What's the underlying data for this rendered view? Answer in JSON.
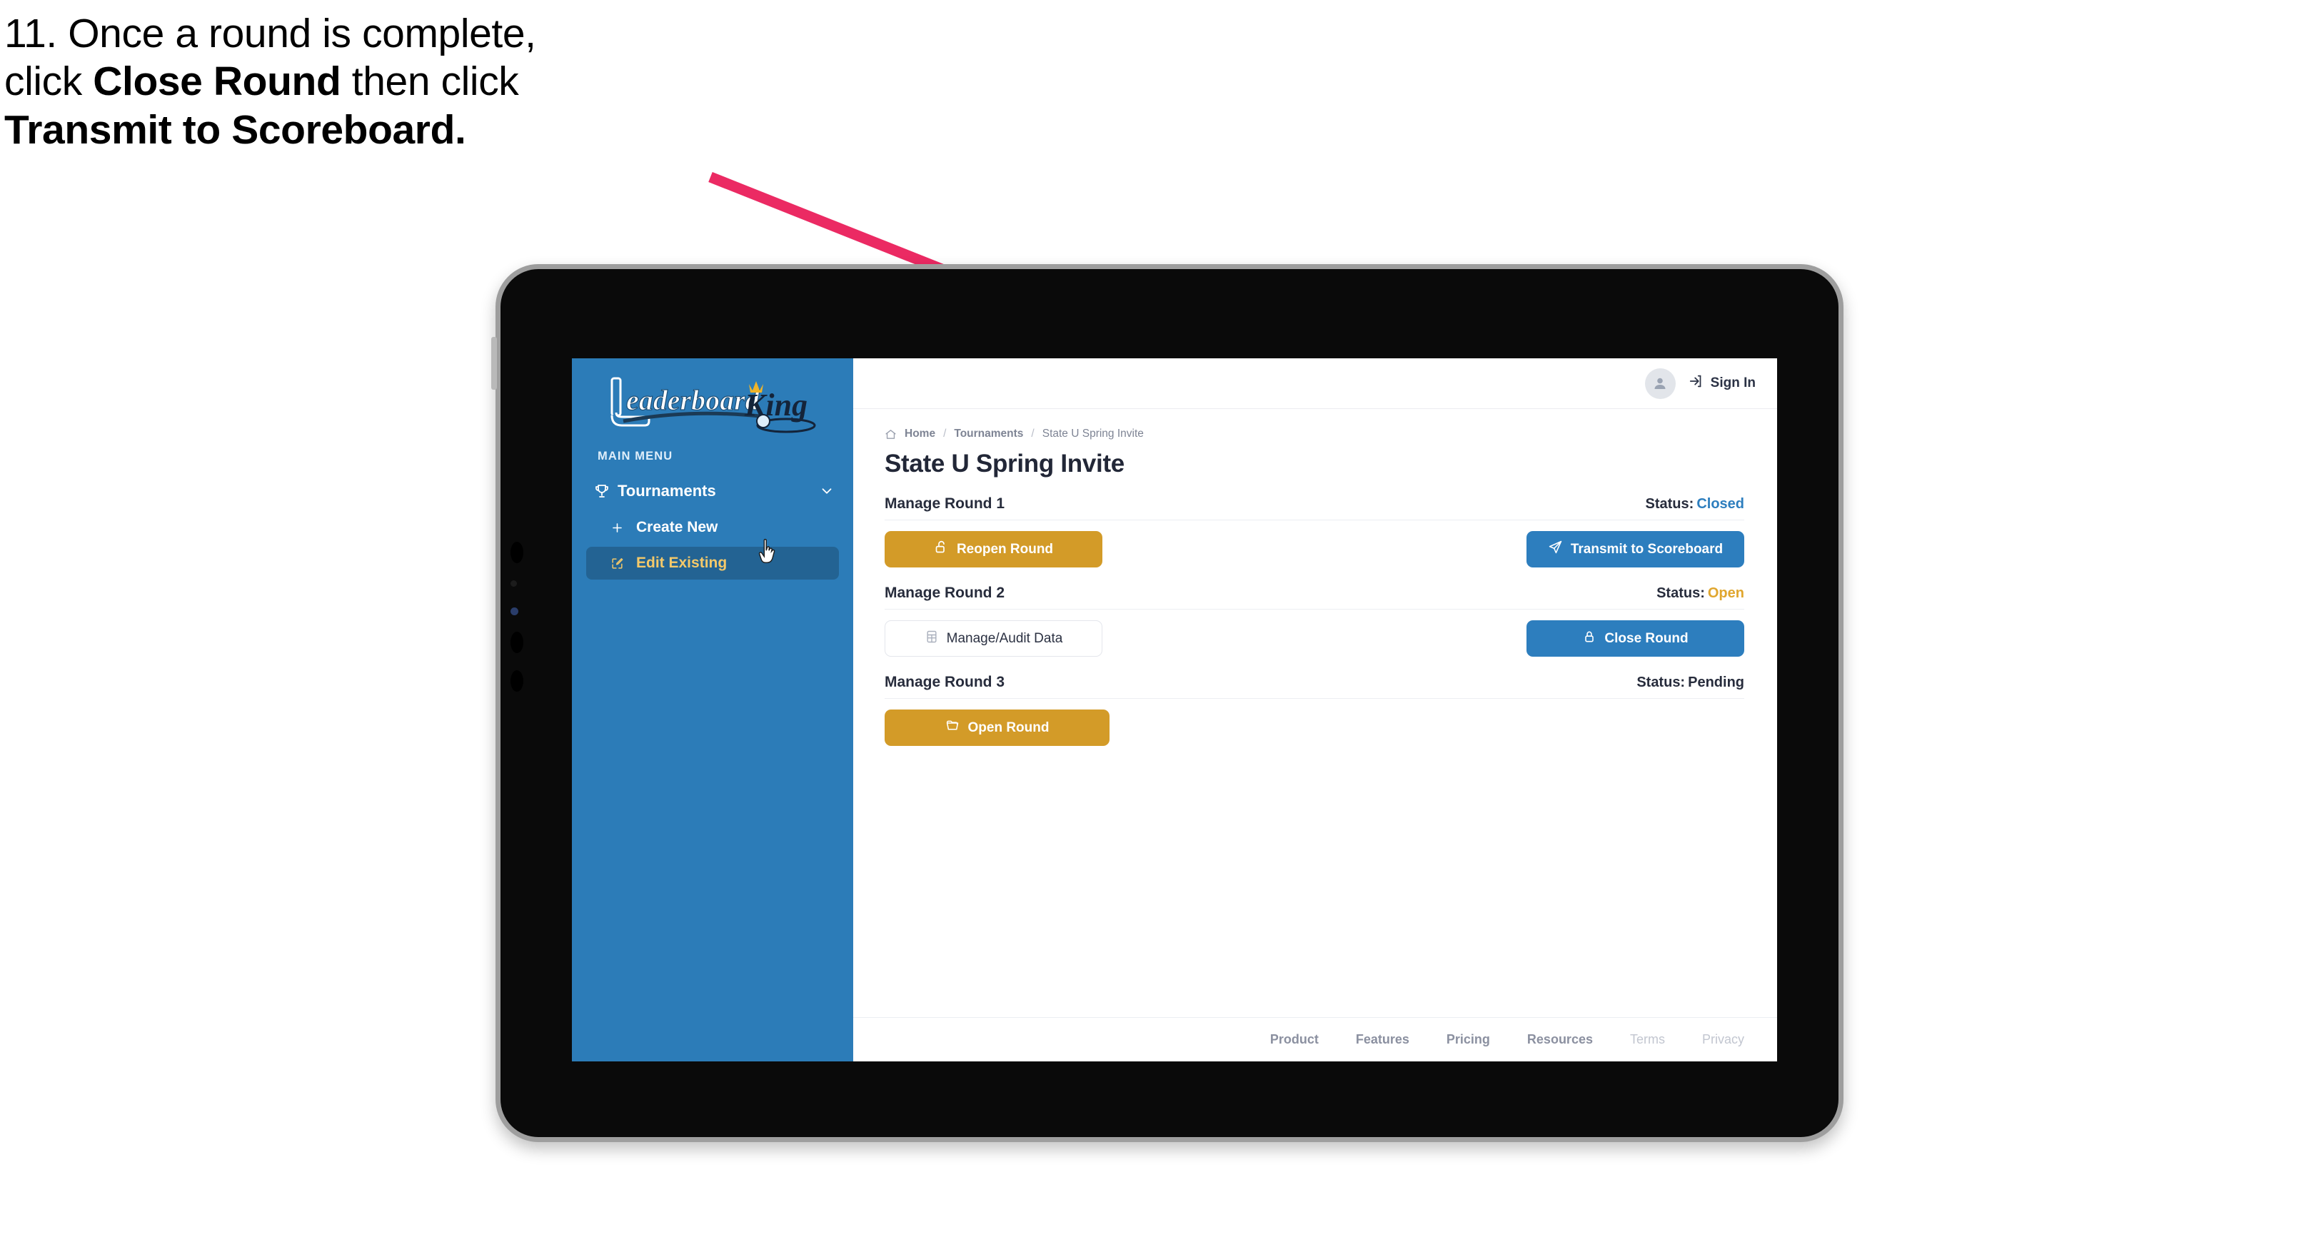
{
  "instruction": {
    "number": "11.",
    "line1_pre": "11. Once a round is complete,",
    "line2_pre": "click ",
    "line2_bold": "Close Round",
    "line2_post": " then click",
    "line3_bold": "Transmit to Scoreboard."
  },
  "app": {
    "logo_primary": "Leaderboard",
    "logo_secondary": "King",
    "sidebar": {
      "section_label": "MAIN MENU",
      "items": [
        {
          "label": "Tournaments",
          "icon": "trophy-icon",
          "expander": "chevron-down-icon",
          "active": false
        },
        {
          "label": "Create New",
          "icon": "plus-icon",
          "active": false
        },
        {
          "label": "Edit Existing",
          "icon": "edit-square-icon",
          "active": true
        }
      ]
    },
    "topbar": {
      "avatar": "user-avatar-icon",
      "signin_label": "Sign In",
      "signin_icon": "login-arrow-icon"
    },
    "breadcrumb": {
      "home_icon": "home-icon",
      "items": [
        "Home",
        "Tournaments",
        "State U Spring Invite"
      ],
      "separator": "/"
    },
    "page_title": "State U Spring Invite",
    "rounds": [
      {
        "name": "Manage Round 1",
        "status_label": "Status:",
        "status_value": "Closed",
        "status_color": "#2d7ebe",
        "left_button": {
          "label": "Reopen Round",
          "icon": "unlock-icon",
          "style": "gold"
        },
        "right_button": {
          "label": "Transmit to Scoreboard",
          "icon": "paper-plane-icon",
          "style": "blue"
        }
      },
      {
        "name": "Manage Round 2",
        "status_label": "Status:",
        "status_value": "Open",
        "status_color": "#e0a62e",
        "left_button": {
          "label": "Manage/Audit Data",
          "icon": "table-grid-icon",
          "style": "ghost"
        },
        "right_button": {
          "label": "Close Round",
          "icon": "lock-icon",
          "style": "blue"
        }
      },
      {
        "name": "Manage Round 3",
        "status_label": "Status:",
        "status_value": "Pending",
        "status_color": "#272c3c",
        "left_button": {
          "label": "Open Round",
          "icon": "folder-open-icon",
          "style": "gold"
        },
        "right_button": null
      }
    ],
    "footer": {
      "links": [
        {
          "label": "Product",
          "muted": false
        },
        {
          "label": "Features",
          "muted": false
        },
        {
          "label": "Pricing",
          "muted": false
        },
        {
          "label": "Resources",
          "muted": false
        },
        {
          "label": "Terms",
          "muted": true
        },
        {
          "label": "Privacy",
          "muted": true
        }
      ]
    }
  },
  "colors": {
    "sidebar_blue": "#2c7cb8",
    "sidebar_active": "#236393",
    "accent_gold": "#d39b28",
    "accent_gold_text": "#f4c96a",
    "primary_blue": "#2d7ebe",
    "arrow_pink": "#eb2a63",
    "text_dark": "#272c3c",
    "text_muted": "#8b90a0"
  }
}
